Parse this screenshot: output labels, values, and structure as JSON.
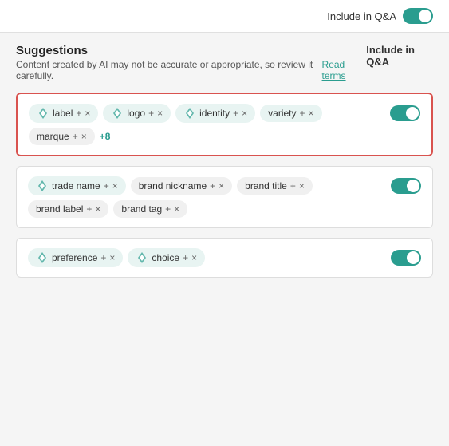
{
  "topbar": {
    "toggle_label": "Include in Q&A",
    "toggle_on": true
  },
  "suggestions": {
    "title": "Suggestions",
    "subtitle": "Content created by AI may not be accurate or appropriate, so review it carefully.",
    "read_terms": "Read terms",
    "column_label": "Include in Q&A"
  },
  "cards": [
    {
      "id": "card1",
      "highlighted": true,
      "toggle_on": true,
      "tags": [
        {
          "text": "label",
          "ai": true,
          "type": "teal"
        },
        {
          "text": "logo",
          "ai": true,
          "type": "teal"
        },
        {
          "text": "identity",
          "ai": true,
          "type": "teal"
        },
        {
          "text": "variety",
          "ai": false,
          "type": "teal"
        },
        {
          "text": "marque",
          "ai": false,
          "type": "plain"
        }
      ],
      "more": "+8"
    },
    {
      "id": "card2",
      "highlighted": false,
      "toggle_on": true,
      "tags": [
        {
          "text": "trade name",
          "ai": true,
          "type": "teal"
        },
        {
          "text": "brand nickname",
          "ai": false,
          "type": "plain"
        },
        {
          "text": "brand title",
          "ai": false,
          "type": "plain"
        },
        {
          "text": "brand label",
          "ai": false,
          "type": "plain"
        },
        {
          "text": "brand tag",
          "ai": false,
          "type": "plain"
        }
      ],
      "more": null
    },
    {
      "id": "card3",
      "highlighted": false,
      "toggle_on": true,
      "tags": [
        {
          "text": "preference",
          "ai": true,
          "type": "teal"
        },
        {
          "text": "choice",
          "ai": true,
          "type": "teal"
        }
      ],
      "more": null
    }
  ],
  "icons": {
    "ai": "◈",
    "plus": "+",
    "close": "×"
  }
}
